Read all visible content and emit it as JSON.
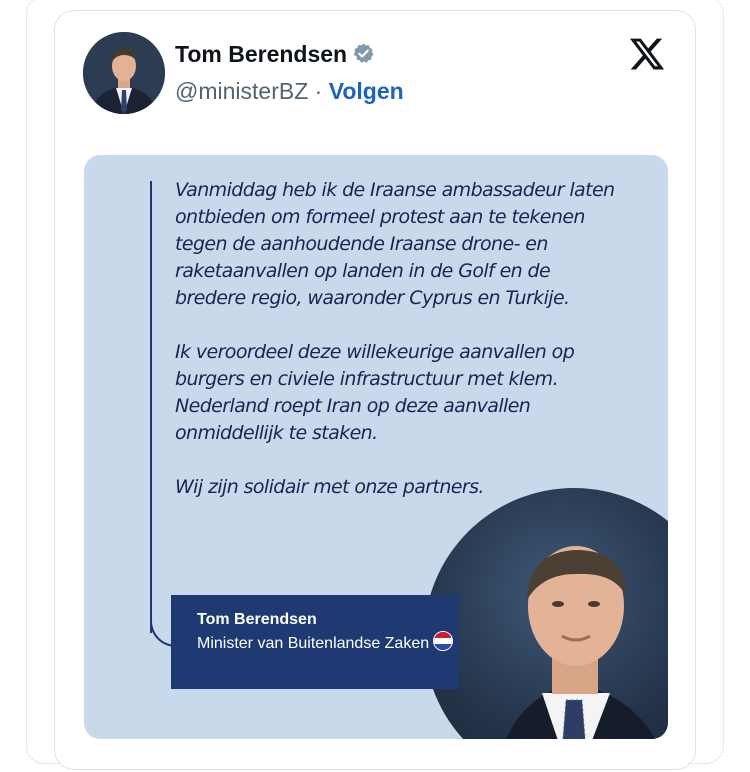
{
  "tweet": {
    "author_name": "Tom Berendsen",
    "handle": "@ministerBZ",
    "separator": "·",
    "follow_label": "Volgen",
    "platform_icon": "x-logo-icon",
    "verified_icon": "verified-badge-icon"
  },
  "image": {
    "paragraphs": [
      "Vanmiddag heb ik de Iraanse ambassadeur laten ontbieden om formeel protest aan te tekenen tegen de aanhoudende Iraanse drone- en raketaanvallen op landen in de Golf en de bredere regio, waaronder Cyprus en Turkije.",
      "Ik veroordeel deze willekeurige aanvallen op burgers en civiele infrastructuur met klem. Nederland roept Iran op deze aanvallen onmiddellijk te staken.",
      "Wij zijn solidair met onze partners."
    ],
    "caption_name": "Tom Berendsen",
    "caption_role": "Minister van Buitenlandse Zaken",
    "flag_icon": "netherlands-flag-icon"
  },
  "colors": {
    "link": "#1d63c2",
    "image_bg": "#c8d9eb",
    "caption_bg": "#1f3a72"
  }
}
